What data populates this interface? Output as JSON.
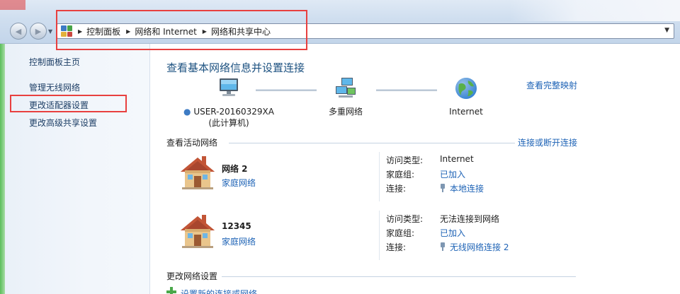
{
  "address_bar": {
    "crumbs": [
      "控制面板",
      "网络和 Internet",
      "网络和共享中心"
    ]
  },
  "sidebar": {
    "items": [
      {
        "label": "控制面板主页"
      },
      {
        "label": "管理无线网络"
      },
      {
        "label": "更改适配器设置"
      },
      {
        "label": "更改高级共享设置"
      }
    ]
  },
  "main": {
    "title": "查看基本网络信息并设置连接",
    "full_map_link": "查看完整映射",
    "map": {
      "computer_name": "USER-20160329XA",
      "computer_sub": "(此计算机)",
      "network": "多重网络",
      "internet": "Internet"
    },
    "active_networks_heading": "查看活动网络",
    "connect_link": "连接或断开连接",
    "networks": [
      {
        "name": "网络  2",
        "type": "家庭网络",
        "access_label": "访问类型:",
        "access_value": "Internet",
        "homegroup_label": "家庭组:",
        "homegroup_value": "已加入",
        "connection_label": "连接:",
        "connection_value": "本地连接"
      },
      {
        "name": "12345",
        "type": "家庭网络",
        "access_label": "访问类型:",
        "access_value": "无法连接到网络",
        "homegroup_label": "家庭组:",
        "homegroup_value": "已加入",
        "connection_label": "连接:",
        "connection_value": "无线网络连接 2"
      }
    ],
    "settings_heading": "更改网络设置",
    "new_connection_link": "设置新的连接或网络"
  },
  "colors": {
    "link": "#1e63b6",
    "title": "#1c5180",
    "highlight": "#e8403f"
  }
}
